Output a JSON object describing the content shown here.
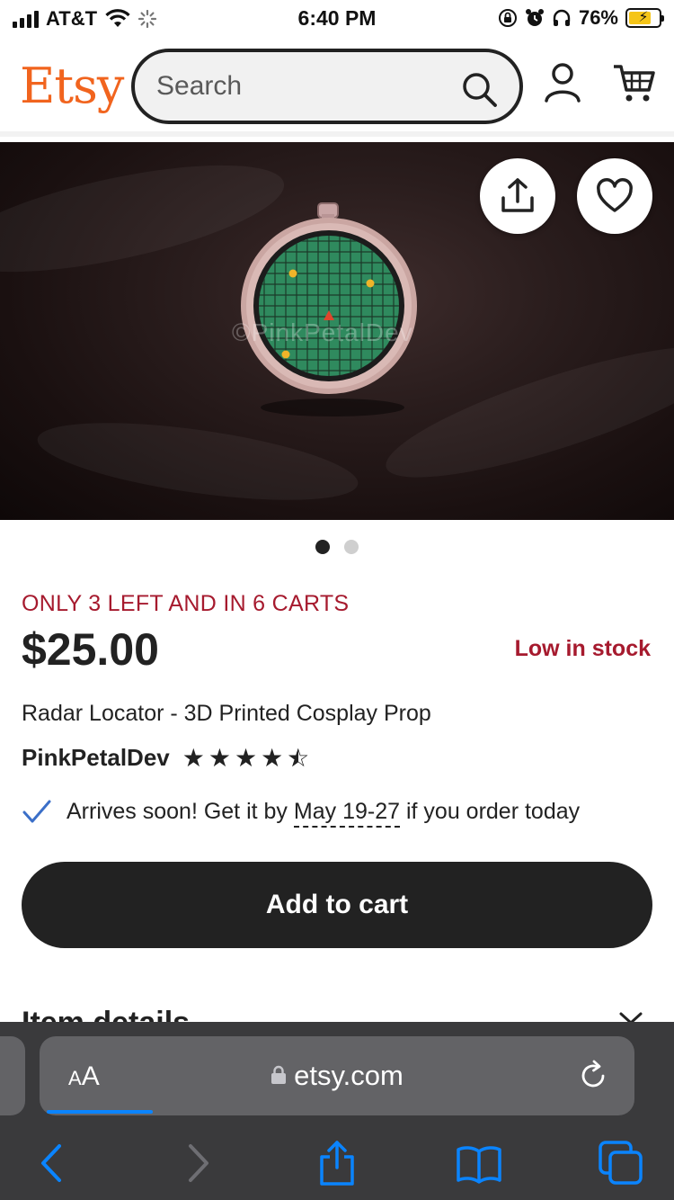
{
  "status_bar": {
    "carrier": "AT&T",
    "time": "6:40 PM",
    "battery": "76%",
    "battery_level": 0.76
  },
  "header": {
    "logo": "Etsy",
    "search_placeholder": "Search"
  },
  "hero": {
    "watermark": "©PinkPetalDev",
    "dots_total": 2,
    "dots_active": 1
  },
  "product": {
    "stock_alert": "ONLY 3 LEFT AND IN 6 CARTS",
    "price": "$25.00",
    "low_stock": "Low in stock",
    "title": "Radar Locator - 3D Printed Cosplay Prop",
    "shop": "PinkPetalDev",
    "rating": 4.5,
    "delivery_prefix": "Arrives soon! Get it by",
    "delivery_dates": "May 19-27",
    "delivery_suffix": "if you order today",
    "add_to_cart": "Add to cart",
    "details_heading": "Item details"
  },
  "browser": {
    "aa_small": "A",
    "aa_large": "A",
    "url": "etsy.com",
    "load_progress": 0.18
  },
  "colors": {
    "brand": "#f1641e",
    "alert": "#a61a2e",
    "dark": "#222222",
    "link_blue": "#0a84ff"
  }
}
